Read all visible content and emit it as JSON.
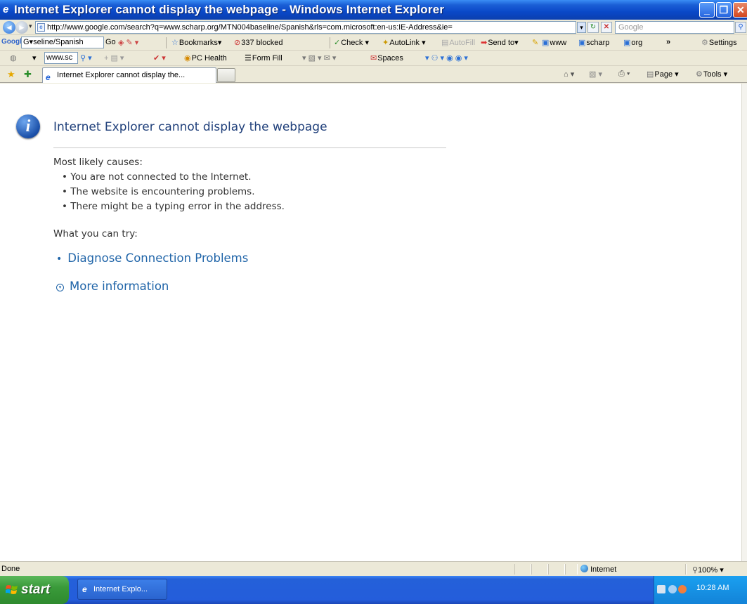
{
  "window": {
    "title": "Internet Explorer cannot display the webpage - Windows Internet Explorer"
  },
  "address_bar": {
    "url": "http://www.google.com/search?q=www.scharp.org/MTN004baseline/Spanish&rls=com.microsoft:en-us:IE-Address&ie=",
    "search_placeholder": "Google"
  },
  "google_toolbar": {
    "logo": "Google",
    "search_value": "G▾seline/Spanish",
    "go_label": "Go",
    "bookmarks_label": "Bookmarks▾",
    "blocked_label": "337 blocked",
    "check_label": "Check ▾",
    "autolink_label": "AutoLink ▾",
    "autofill_label": "AutoFill",
    "sendto_label": "Send to▾",
    "www_label": "www",
    "scharp_label": "scharp",
    "org_label": "org",
    "overflow_label": "»",
    "settings_label": "Settings"
  },
  "links_toolbar": {
    "search_value": "www.sc",
    "pchealth_label": "PC Health",
    "formfill_label": "Form Fill",
    "spaces_label": "Spaces"
  },
  "tabs": {
    "active_label": "Internet Explorer cannot display the...",
    "page_label": "Page ▾",
    "tools_label": "Tools ▾"
  },
  "content": {
    "heading": "Internet Explorer cannot display the webpage",
    "causes_title": "Most likely causes:",
    "causes": [
      "You are not connected to the Internet.",
      "The website is encountering problems.",
      "There might be a typing error in the address."
    ],
    "try_title": "What you can try:",
    "diagnose_link": "Diagnose Connection Problems",
    "more_info_link": "More information"
  },
  "status_bar": {
    "status": "Done",
    "zone": "Internet",
    "zoom": "100%"
  },
  "taskbar": {
    "start_label": "start",
    "task_label": "Internet Explo...",
    "clock": "10:28 AM"
  },
  "colors": {
    "titlebar": "#0a48c8",
    "link": "#1f64a8",
    "heading": "#1f3f7a",
    "start_button": "#3a9a3a"
  }
}
